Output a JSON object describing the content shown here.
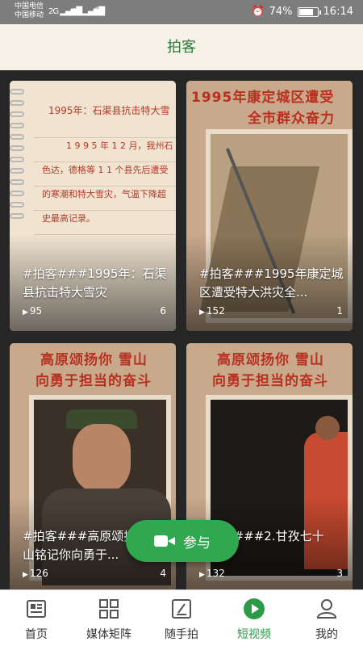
{
  "status_bar": {
    "carrier_1": "中国电信",
    "carrier_2": "中国移动",
    "network_1": "2G",
    "network_2": "4G",
    "battery": "74%",
    "time": "16:14"
  },
  "header": {
    "title": "拍客"
  },
  "cards": [
    {
      "title": "#拍客###1995年：石渠县抗击特大雪灾",
      "plays": "95",
      "count": "6",
      "thumb_text": [
        "1995年：石渠县抗击特大雪",
        "1 9 9 5 年 1 2 月，我州石",
        "色达，德格等 1 1 个县先后遭受",
        "的寒潮和特大雪灾，气温下降超",
        "史最高记录。"
      ]
    },
    {
      "title": "#拍客###1995年康定城区遭受特大洪灾全...",
      "plays": "152",
      "count": "1",
      "thumb_text": [
        "1995年康定城区遭受",
        "全市群众奋力"
      ]
    },
    {
      "title": "#拍客###高原颂扬你 雪山铭记你向勇于...",
      "plays": "126",
      "count": "4",
      "thumb_text": [
        "高原颂扬你  雪山",
        "向勇于担当的奋斗"
      ]
    },
    {
      "title": "#拍客###2.甘孜七十",
      "plays": "132",
      "count": "3",
      "thumb_text": [
        "高原颂扬你  雪山",
        "向勇于担当的奋斗"
      ]
    }
  ],
  "fab": {
    "label": "参与"
  },
  "nav": [
    {
      "label": "首页",
      "icon": "home-news-icon"
    },
    {
      "label": "媒体矩阵",
      "icon": "grid-icon"
    },
    {
      "label": "随手拍",
      "icon": "edit-icon"
    },
    {
      "label": "短视频",
      "icon": "play-circle-icon"
    },
    {
      "label": "我的",
      "icon": "person-icon"
    }
  ],
  "colors": {
    "accent": "#2d9a48",
    "header_bg": "#f6f2e7",
    "title_green": "#2d7a3c",
    "banner_red": "#b83020"
  }
}
